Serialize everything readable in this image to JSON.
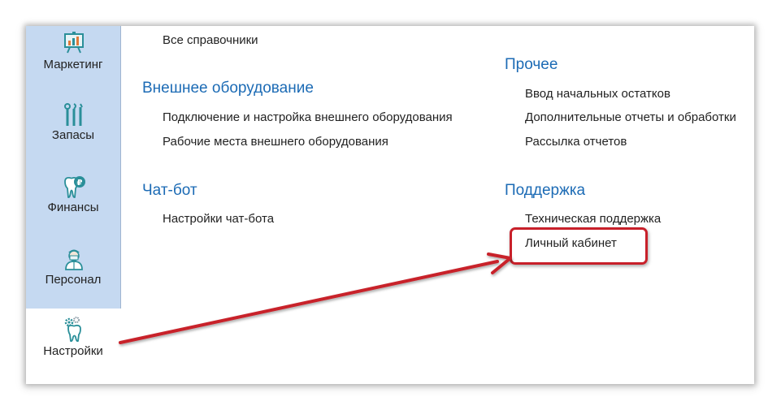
{
  "sidebar": {
    "items": [
      {
        "label": "Маркетинг",
        "icon": "marketing-board-icon"
      },
      {
        "label": "Запасы",
        "icon": "dental-tools-icon"
      },
      {
        "label": "Финансы",
        "icon": "tooth-ruble-icon"
      },
      {
        "label": "Персонал",
        "icon": "doctor-icon"
      },
      {
        "label": "Настройки",
        "icon": "tooth-gears-icon"
      }
    ],
    "active_index": 4
  },
  "content": {
    "top_link": "Все справочники",
    "sections": {
      "external_equipment": {
        "title": "Внешнее оборудование",
        "links": [
          "Подключение и настройка внешнего оборудования",
          "Рабочие места внешнего оборудования"
        ]
      },
      "chatbot": {
        "title": "Чат-бот",
        "links": [
          "Настройки чат-бота"
        ]
      },
      "other": {
        "title": "Прочее",
        "links": [
          "Ввод начальных остатков",
          "Дополнительные отчеты и обработки",
          "Рассылка отчетов"
        ]
      },
      "support": {
        "title": "Поддержка",
        "links": [
          "Техническая поддержка",
          "Личный кабинет"
        ]
      }
    }
  },
  "colors": {
    "sidebar_bg": "#c5d9f1",
    "heading": "#1c6bb5",
    "annotation": "#c8202a",
    "icon_teal": "#2a8f99"
  }
}
